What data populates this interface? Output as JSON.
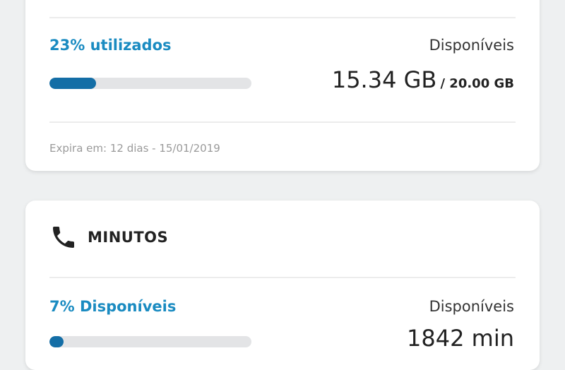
{
  "data_card": {
    "percent_label": "23% utilizados",
    "available_label": "Disponíveis",
    "amount_main": "15.34 GB",
    "amount_total": "/ 20.00 GB",
    "usage_fraction": 0.23,
    "expiry_text": "Expira em: 12 dias - 15/01/2019"
  },
  "minutes_card": {
    "icon": "phone-icon",
    "title": "MINUTOS",
    "percent_label": "7% Disponíveis",
    "available_label": "Disponíveis",
    "amount_main": "1842 min",
    "usage_fraction": 0.07
  },
  "colors": {
    "accent": "#1a8bc1",
    "bar_fill": "#146ea6",
    "bar_track": "#e3e4e6",
    "background": "#eef0f1"
  }
}
